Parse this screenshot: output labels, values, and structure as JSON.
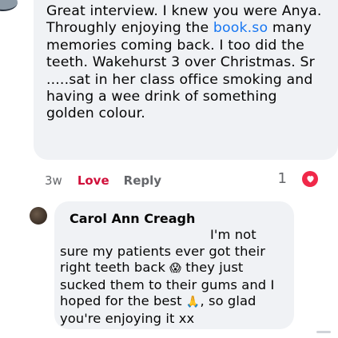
{
  "comment": {
    "text_before_link": "Great interview. I knew you were Anya. Throughly enjoying the ",
    "link_text": "book.so",
    "text_after_link": " many memories coming back. I too did the teeth. Wakehurst 3 over Christmas. Sr .....sat in her class office smoking and having a wee drink of something golden colour.",
    "time": "3w",
    "love_label": "Love",
    "reply_label": "Reply",
    "reaction_count": "1",
    "reaction_icon": "heart-icon",
    "colors": {
      "link": "#1877f2",
      "love": "#d0103a",
      "bubble": "#f0f2f5",
      "reaction": "#f02849"
    }
  },
  "reply": {
    "author": "Carol Ann Creagh",
    "text_part1": "I'm not sure my patients ever got their right teeth back ",
    "emoji_1": "😱",
    "text_part2": " they just sucked them to their gums and I hoped for the best ",
    "emoji_2": "🙏",
    "text_part3": ", so glad you're enjoying it xx"
  }
}
